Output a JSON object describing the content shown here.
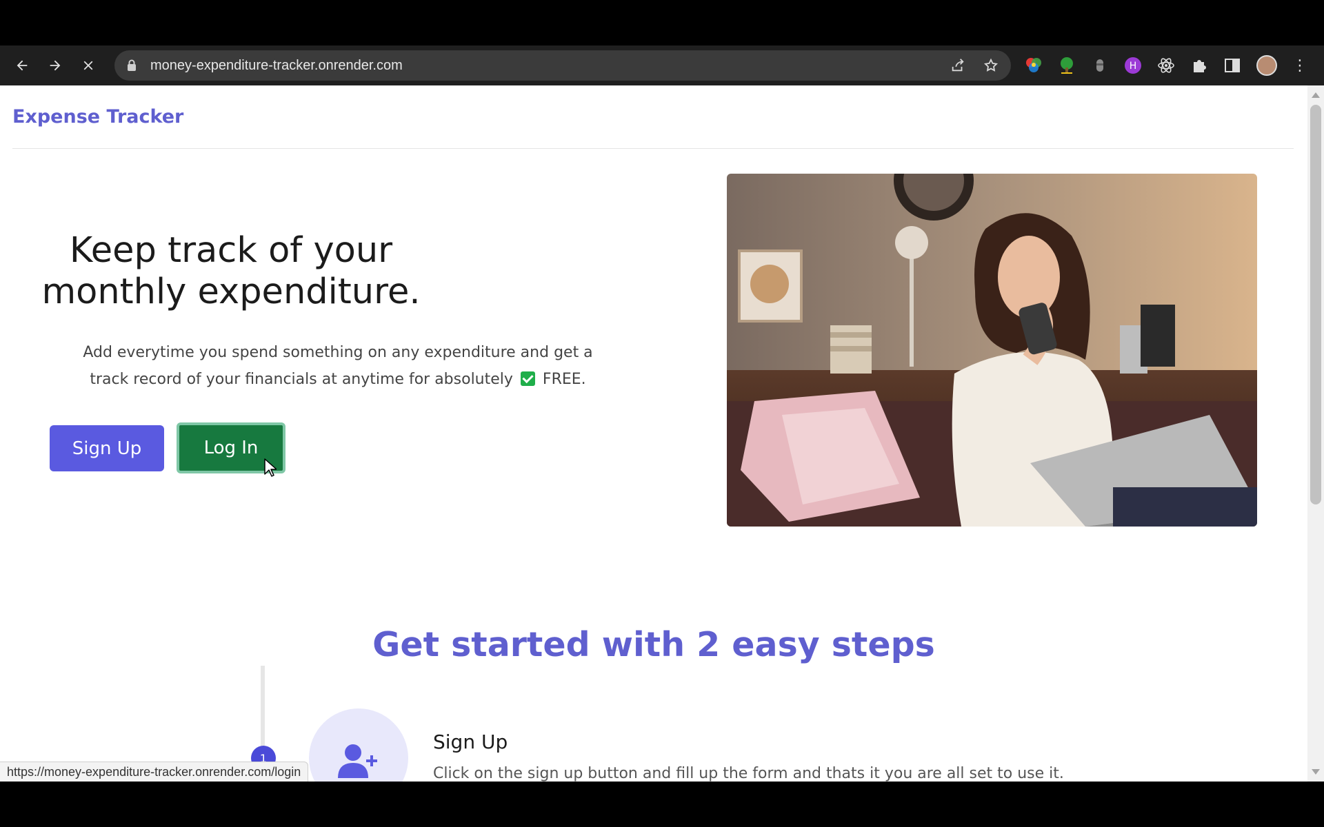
{
  "browser": {
    "url": "money-expenditure-tracker.onrender.com",
    "status_url": "https://money-expenditure-tracker.onrender.com/login"
  },
  "app": {
    "brand": "Expense Tracker"
  },
  "hero": {
    "title_line1": "Keep track of your",
    "title_line2": "monthly expenditure.",
    "subtitle_part1": "Add everytime you spend something on any expenditure and get a track record of your financials at anytime for absolutely",
    "subtitle_part2": "FREE.",
    "signup_label": "Sign Up",
    "login_label": "Log In"
  },
  "steps": {
    "title": "Get started with 2 easy steps",
    "items": [
      {
        "number": "1",
        "heading": "Sign Up",
        "text": "Click on the sign up button and fill up the form and thats it you are all set to use it."
      }
    ]
  },
  "colors": {
    "accent": "#5f5fcf",
    "login_green": "#17793f",
    "signup_blue": "#5a5ae0"
  }
}
